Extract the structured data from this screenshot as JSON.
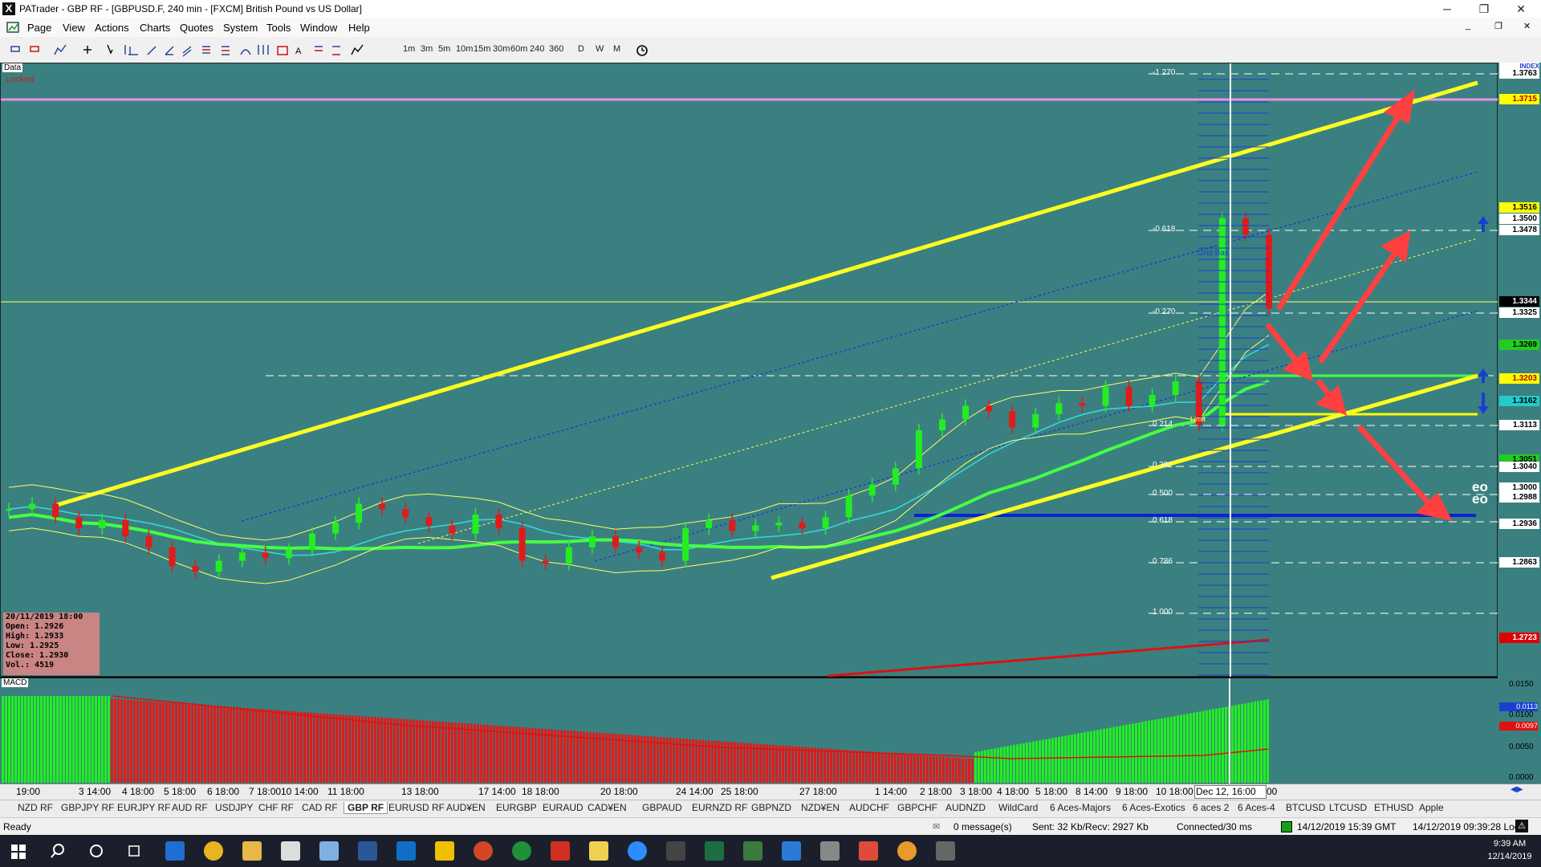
{
  "window": {
    "title": "PATrader - GBP RF - [GBPUSD.F, 240 min - [FXCM] British Pound vs US Dollar]",
    "app_icon": "X",
    "minimize": "─",
    "restore": "❐",
    "close": "✕"
  },
  "menu": [
    "Page",
    "View",
    "Actions",
    "Charts",
    "Quotes",
    "System",
    "Tools",
    "Window",
    "Help"
  ],
  "toolbar": {
    "timeframes": [
      "1m",
      "3m",
      "5m",
      "10m",
      "15m",
      "30m",
      "60m",
      "240",
      "360",
      "D",
      "W",
      "M"
    ]
  },
  "chart": {
    "data_label": "Data",
    "locked_label": "Locked",
    "index_label": "INDEX",
    "grid_label": "Grid Bas",
    "limit_label": "Limit",
    "eo_label": "eo",
    "fib_labels": [
      "-1.270",
      "-0.618",
      "-0.270",
      "0.214",
      "0.382",
      "0.500",
      "0.618",
      "0.786",
      "1.000"
    ],
    "price_labels": [
      {
        "text": "1.3763",
        "bg": "#ffffff",
        "fg": "#000000"
      },
      {
        "text": "1.3715",
        "bg": "#ffff00",
        "fg": "#b00000"
      },
      {
        "text": "1.3516",
        "bg": "#ffff00",
        "fg": "#000000"
      },
      {
        "text": "1.3500",
        "bg": "#ffffff",
        "fg": "#000000"
      },
      {
        "text": "1.3478",
        "bg": "#ffffff",
        "fg": "#000000"
      },
      {
        "text": "1.3344",
        "bg": "#000000",
        "fg": "#ffffff"
      },
      {
        "text": "1.3325",
        "bg": "#ffffff",
        "fg": "#000000"
      },
      {
        "text": "1.3269",
        "bg": "#22cc22",
        "fg": "#000000"
      },
      {
        "text": "1.3203",
        "bg": "#ffff00",
        "fg": "#b00000"
      },
      {
        "text": "1.3162",
        "bg": "#22cccc",
        "fg": "#000000"
      },
      {
        "text": "1.3113",
        "bg": "#ffffff",
        "fg": "#000000"
      },
      {
        "text": "1.3051",
        "bg": "#22cc22",
        "fg": "#000000"
      },
      {
        "text": "1.3040",
        "bg": "#ffffff",
        "fg": "#000000"
      },
      {
        "text": "1.3000",
        "bg": "#ffffff",
        "fg": "#000000"
      },
      {
        "text": "1.2988",
        "bg": "#ffffff",
        "fg": "#000000"
      },
      {
        "text": "1.2936",
        "bg": "#ffffff",
        "fg": "#000000"
      },
      {
        "text": "1.2863",
        "bg": "#ffffff",
        "fg": "#000000"
      },
      {
        "text": "1.2723",
        "bg": "#dd0000",
        "fg": "#ffffff"
      }
    ],
    "info_box": {
      "date": "20/11/2019 18:00",
      "open": "Open: 1.2926",
      "high": "High: 1.2933",
      "low": "Low: 1.2925",
      "close": "Close: 1.2930",
      "vol": "Vol.: 4519"
    },
    "macd": {
      "label": "MACD",
      "scale": [
        "0.0150",
        "0.0100",
        "0.0050",
        "0.0000"
      ],
      "value_blue": "0.0113",
      "value_red": "0.0097"
    },
    "date_labels": [
      "19:00",
      "3 14:00",
      "4 18:00",
      "5 18:00",
      "6 18:00",
      "7 18:00",
      "10 14:00",
      "11 18:00",
      "13 18:00",
      "17 14:00",
      "18 18:00",
      "20 18:00",
      "24 14:00",
      "25 18:00",
      "27 18:00",
      "1 14:00",
      "2 18:00",
      "3 18:00",
      "4 18:00",
      "5 18:00",
      "8 14:00",
      "9 18:00",
      "10 18:00",
      "Dec 12, 16:00",
      "00"
    ]
  },
  "chart_data": {
    "type": "candlestick",
    "title": "GBPUSD.F, 240 min - [FXCM] British Pound vs US Dollar",
    "ylim": [
      1.268,
      1.378
    ],
    "close_series": [
      1.2975,
      1.2985,
      1.296,
      1.294,
      1.2955,
      1.2925,
      1.2905,
      1.287,
      1.286,
      1.288,
      1.2895,
      1.2885,
      1.29,
      1.293,
      1.295,
      1.2985,
      1.2975,
      1.296,
      1.2945,
      1.293,
      1.2965,
      1.294,
      1.288,
      1.2875,
      1.2905,
      1.2925,
      1.2905,
      1.2895,
      1.288,
      1.294,
      1.2955,
      1.2935,
      1.2945,
      1.295,
      1.294,
      1.296,
      1.3,
      1.302,
      1.305,
      1.312,
      1.314,
      1.3165,
      1.3155,
      1.3125,
      1.315,
      1.317,
      1.3165,
      1.32,
      1.3165,
      1.3185,
      1.321,
      1.313,
      1.351,
      1.348,
      1.3344
    ],
    "trend_lines": "yellow channel lines, blue dotted channel, fibonacci levels",
    "fib_levels": [
      -1.27,
      -0.618,
      -0.27,
      0.214,
      0.382,
      0.5,
      0.618,
      0.786,
      1.0
    ],
    "horizontal_levels": [
      1.3715,
      1.3203,
      1.3134,
      1.2936
    ],
    "macd": {
      "scale": [
        0.0,
        0.005,
        0.01,
        0.015
      ],
      "histogram_sign_pattern": "positive, then negative, then positive rising",
      "last_values": {
        "blue": 0.0113,
        "red": 0.0097
      }
    }
  },
  "tabs": [
    "NZD RF",
    "GBPJPY RF",
    "EURJPY RF",
    "AUD RF",
    "USDJPY",
    "CHF RF",
    "CAD RF",
    "GBP RF",
    "EURUSD RF",
    "AUD¥EN",
    "EURGBP",
    "EURAUD",
    "CAD¥EN",
    "GBPAUD",
    "EURNZD RF",
    "GBPNZD",
    "NZD¥EN",
    "AUDCHF",
    "GBPCHF",
    "AUDNZD",
    "WildCard",
    "6 Aces-Majors",
    "6 Aces-Exotics",
    "6 aces 2",
    "6 Aces-4",
    "BTCUSD",
    "LTCUSD",
    "ETHUSD",
    "Apple"
  ],
  "active_tab": "GBP RF",
  "status": {
    "ready": "Ready",
    "messages": "0 message(s)",
    "traffic": "Sent: 32 Kb/Recv: 2927 Kb",
    "connection": "Connected/30 ms",
    "gmt_time": "14/12/2019 15:39 GMT",
    "local_time": "14/12/2019 09:39:28 Local"
  },
  "taskbar": {
    "time": "9:39 AM",
    "date": "12/14/2019"
  }
}
